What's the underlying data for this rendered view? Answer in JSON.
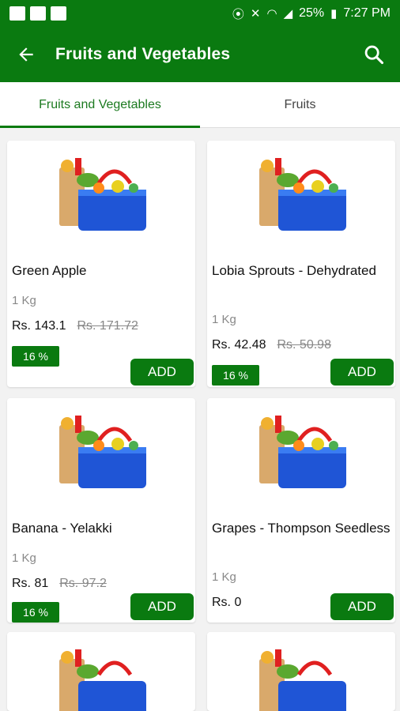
{
  "status_bar": {
    "battery": "25%",
    "time": "7:27 PM"
  },
  "app_bar": {
    "title": "Fruits and Vegetables"
  },
  "tabs": [
    {
      "label": "Fruits and Vegetables",
      "active": true
    },
    {
      "label": "Fruits",
      "active": false
    }
  ],
  "colors": {
    "brand_green": "#0a7a10"
  },
  "products": [
    {
      "name": "Green Apple",
      "qty": "1 Kg",
      "price": "Rs. 143.1",
      "old_price": "Rs. 171.72",
      "discount": "16 %",
      "add_label": "ADD"
    },
    {
      "name": "Lobia Sprouts - Dehydrated",
      "qty": "1 Kg",
      "price": "Rs. 42.48",
      "old_price": "Rs. 50.98",
      "discount": "16 %",
      "add_label": "ADD"
    },
    {
      "name": "Banana - Yelakki",
      "qty": "1 Kg",
      "price": "Rs. 81",
      "old_price": "Rs. 97.2",
      "discount": "16 %",
      "add_label": "ADD"
    },
    {
      "name": "Grapes - Thompson Seedless",
      "qty": "1 Kg",
      "price": "Rs. 0",
      "old_price": "",
      "discount": "",
      "add_label": "ADD"
    }
  ]
}
